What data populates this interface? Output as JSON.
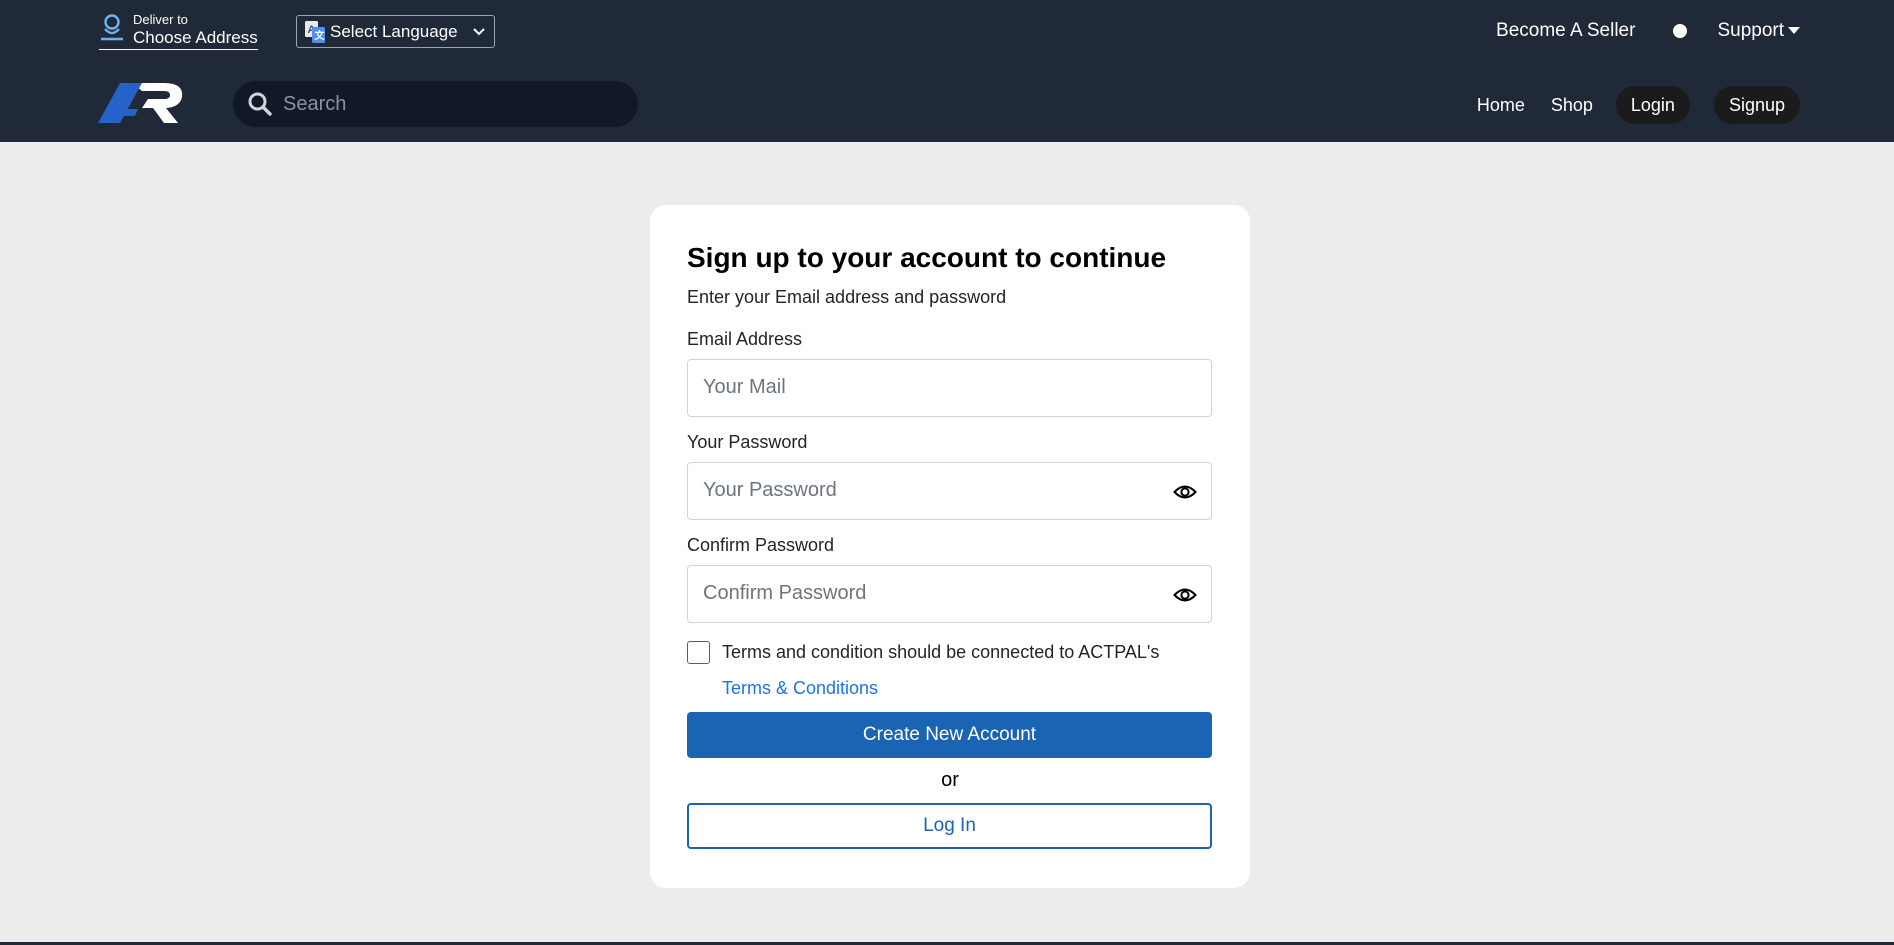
{
  "topbar": {
    "deliver_label": "Deliver to",
    "address_label": "Choose Address",
    "language_select": "Select Language",
    "become_seller": "Become A Seller",
    "support": "Support"
  },
  "navbar": {
    "search_placeholder": "Search",
    "links": {
      "home": "Home",
      "shop": "Shop",
      "login": "Login",
      "signup": "Signup"
    }
  },
  "form": {
    "title": "Sign up to your account to continue",
    "subtitle": "Enter your Email address and password",
    "email_label": "Email Address",
    "email_placeholder": "Your Mail",
    "password_label": "Your Password",
    "password_placeholder": "Your Password",
    "confirm_label": "Confirm Password",
    "confirm_placeholder": "Confirm Password",
    "terms_text": "Terms and condition should be connected to ACTPAL's",
    "terms_link": "Terms & Conditions",
    "terms_checked": false,
    "create_button": "Create New Account",
    "or_text": "or",
    "login_button": "Log In"
  },
  "colors": {
    "header_bg": "#1f2937",
    "page_bg": "#edecea",
    "primary": "#1b64b3",
    "link": "#1e73e8"
  },
  "icons": [
    "user-pin-icon",
    "translate-icon",
    "chevron-down-icon",
    "caret-down-icon",
    "search-icon",
    "eye-icon"
  ]
}
